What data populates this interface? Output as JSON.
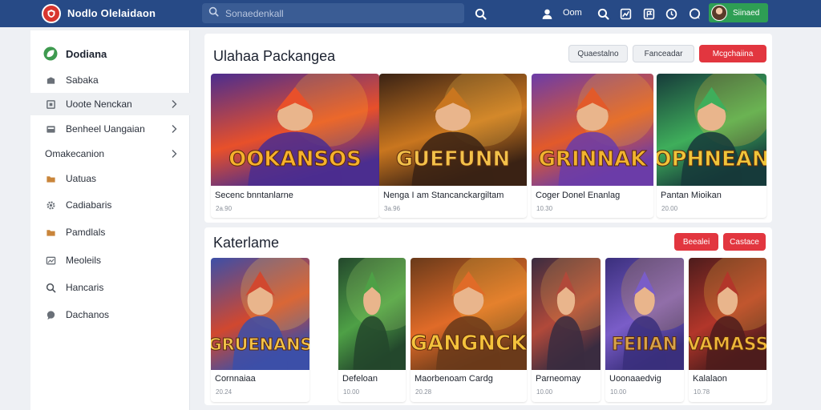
{
  "app": {
    "title": "Nodlo Olelaidaon",
    "logo_icon": "shield-icon"
  },
  "search": {
    "placeholder": "Sonaedenkall"
  },
  "topbar": {
    "user_label": "Oom",
    "profile_name": "Siinaed"
  },
  "sidebar": {
    "heading": "Dodiana",
    "items": [
      {
        "label": "Sabaka",
        "icon": "box-icon"
      },
      {
        "label": "Uoote Nenckan",
        "icon": "square-icon",
        "chevron": true,
        "active": true
      },
      {
        "label": "Benheel Uangaian",
        "icon": "card-icon",
        "chevron": true
      },
      {
        "label": "Omakecanion",
        "icon": "",
        "chevron": true
      },
      {
        "label": "Uatuas",
        "icon": "folder-icon"
      },
      {
        "label": "Cadiabaris",
        "icon": "gear-icon"
      },
      {
        "label": "Pamdlals",
        "icon": "folder-icon"
      },
      {
        "label": "Meoleils",
        "icon": "image-icon"
      },
      {
        "label": "Hancaris",
        "icon": "search-icon"
      },
      {
        "label": "Dachanos",
        "icon": "chat-icon"
      }
    ]
  },
  "featured": {
    "title": "Ulahaa Packangea",
    "buttons": [
      "Quaestalno",
      "Fanceadar",
      "Mcgchaiina"
    ],
    "cards": [
      {
        "name": "Secenc bnntanlarne",
        "meta": "2a.90",
        "art_text": "OOKANSOS",
        "palette": [
          "#4b2d8f",
          "#e8502a",
          "#f6b12c"
        ]
      },
      {
        "name": "Nenga I am Stancanckargiltam",
        "meta": "3a.96",
        "art_text": "GUEFUNN",
        "palette": [
          "#3a2214",
          "#c9761f",
          "#f3c14a"
        ]
      },
      {
        "name": "Coger Donel Enanlag",
        "meta": "10.30",
        "art_text": "GRINNAK",
        "palette": [
          "#6b3ca8",
          "#e25a2a",
          "#f2b32f"
        ]
      },
      {
        "name": "Pantan Mioikan",
        "meta": "20.00",
        "art_text": "OPHNEAN",
        "palette": [
          "#163a3a",
          "#3fae5b",
          "#f0c53a"
        ]
      }
    ]
  },
  "catalog": {
    "title": "Katerlame",
    "buttons": [
      "Beealei",
      "Castace"
    ],
    "cards": [
      {
        "name": "Cornnaiaa",
        "meta": "20.24",
        "art_text": "GRUENANS",
        "palette": [
          "#3c4fa8",
          "#d1482f",
          "#f3c34a"
        ]
      },
      {
        "name": "Defeloan",
        "meta": "10.00",
        "art_text": "",
        "palette": [
          "#23472c",
          "#4ea046",
          "#9fd36a"
        ]
      },
      {
        "name": "Maorbenoam Cardg",
        "meta": "20.28",
        "art_text": "GANGNCK",
        "palette": [
          "#6a3a1a",
          "#e06b28",
          "#f4c23c"
        ]
      },
      {
        "name": "Parneomay",
        "meta": "10.00",
        "art_text": "",
        "palette": [
          "#3a2c40",
          "#b1493a",
          "#e4a34c"
        ]
      },
      {
        "name": "Uoonaaedvig",
        "meta": "10.00",
        "art_text": "FEIIAN",
        "palette": [
          "#3a2f7c",
          "#7a5dc8",
          "#d8a34a"
        ]
      },
      {
        "name": "Kalalaon",
        "meta": "10.78",
        "art_text": "VAMASS",
        "palette": [
          "#4d1c1c",
          "#b2362a",
          "#f0b83a"
        ]
      }
    ]
  },
  "colors": {
    "topbar": "#274a86",
    "accent_red": "#e2363f",
    "profile_green": "#2e9e54"
  }
}
